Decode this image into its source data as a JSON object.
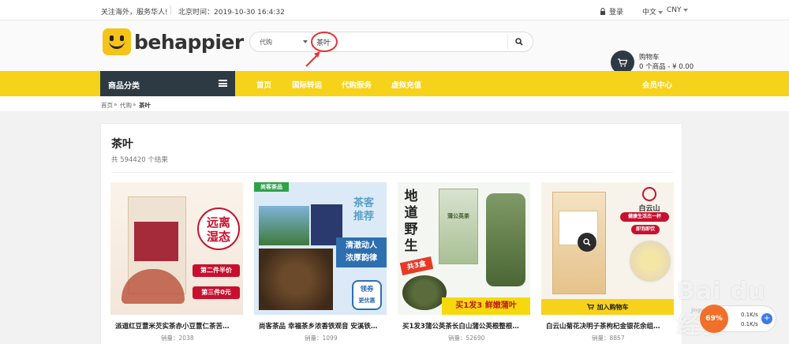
{
  "topbar": {
    "slogan": "关注海外，服务华人!",
    "time_label": "北京时间：2019-10-30 16:4:32",
    "login": "登录",
    "language": "中文",
    "currency": "CNY"
  },
  "logo": {
    "text_left": "be",
    "text_right": "happier"
  },
  "search": {
    "category": "代购",
    "query": "茶叶",
    "icon": "search-icon"
  },
  "cart": {
    "title": "购物车",
    "summary": "0 个商品 - ¥ 0.00",
    "icon": "cart-icon"
  },
  "nav": {
    "category_label": "商品分类",
    "items": [
      {
        "label": "首页"
      },
      {
        "label": "国际转运"
      },
      {
        "label": "代购服务"
      },
      {
        "label": "虚拟充值"
      }
    ],
    "member": "会员中心"
  },
  "breadcrumb": {
    "items": [
      {
        "label": "首页"
      },
      {
        "label": "代购"
      },
      {
        "label": "茶叶"
      }
    ],
    "separator": "»"
  },
  "results": {
    "title": "茶叶",
    "count": "共 594420 个结果"
  },
  "products": [
    {
      "name": "派道红豆薏米芡实茶赤小豆薏仁茶苦…",
      "sales": "销量：2038",
      "image_text": [
        "远离",
        "湿态",
        "第二件半价",
        "第三件0元"
      ]
    },
    {
      "name": "尚客茶品 幸福茶乡浓香铁观音 安溪铁…",
      "sales": "销量：1099",
      "image_text": [
        "尚客茶品",
        "茶客",
        "推荐",
        "清澈动人",
        "浓厚韵律",
        "领券",
        "更优惠"
      ]
    },
    {
      "name": "买1发3蒲公英茶长白山蒲公英根整根…",
      "sales": "销量：52690",
      "image_text": [
        "地道",
        "野生",
        "共3盒",
        "买1发3 鲜嫩蒲叶",
        "蒲公英茶"
      ]
    },
    {
      "name": "白云山菊花决明子茶枸杞金银花余组…",
      "sales": "销量：8857",
      "image_text": [
        "白云山",
        "健康生活杰一杯",
        "即泡即饮"
      ],
      "add_to_cart": "加入购物车"
    }
  ],
  "speed_widget": {
    "label": "69%",
    "up": "0.1K/s",
    "down": "0.1K/s",
    "plus": "+"
  },
  "watermark": {
    "text": "Bai du 经验",
    "sub": "jingyan.baidu.com"
  },
  "colors": {
    "accent": "#f7d21a",
    "dark": "#2e3a43",
    "annotation": "#e23333"
  }
}
